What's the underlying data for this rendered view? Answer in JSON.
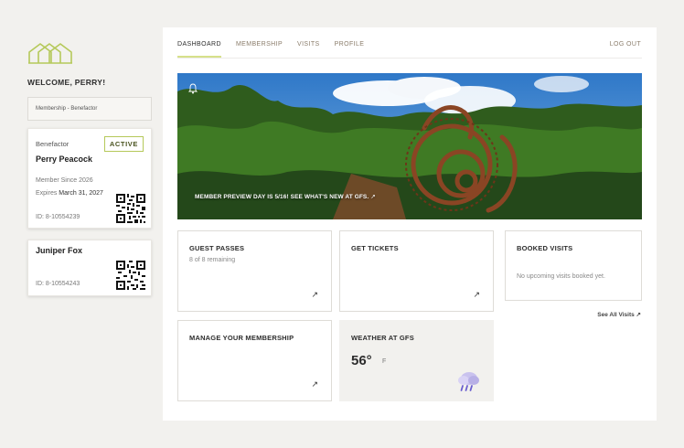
{
  "sidebar": {
    "logo": "home-outline-logo",
    "welcome": "WELCOME, PERRY!",
    "membership_select": "Membership - Benefactor",
    "cards": [
      {
        "tier": "Benefactor",
        "status": "ACTIVE",
        "name": "Perry Peacock",
        "since": "Member Since 2026",
        "expires_label": "Expires",
        "expires_date": "March 31, 2027",
        "id": "ID: 8-10554239"
      },
      {
        "name": "Juniper Fox",
        "id": "ID: 8-10554243"
      }
    ]
  },
  "nav": {
    "tabs": [
      "DASHBOARD",
      "MEMBERSHIP",
      "VISITS",
      "PROFILE"
    ],
    "active": "DASHBOARD",
    "logout": "LOG OUT"
  },
  "hero": {
    "text": "MEMBER PREVIEW DAY IS 5/16! SEE WHAT'S NEW AT GFS.",
    "arrow": "↗"
  },
  "tiles": {
    "guest_passes": {
      "title": "GUEST PASSES",
      "sub": "8 of 8 remaining",
      "arrow": "↗"
    },
    "tickets": {
      "title": "GET TICKETS",
      "arrow": "↗"
    },
    "booked": {
      "title": "BOOKED VISITS",
      "sub": "No upcoming visits booked yet."
    },
    "see_all": "See All Visits ↗",
    "manage": {
      "title": "MANAGE YOUR MEMBERSHIP",
      "arrow": "↗"
    },
    "weather": {
      "title": "WEATHER AT GFS",
      "temp": "56°",
      "unit": "F",
      "icon": "rain-cloud-icon"
    }
  },
  "colors": {
    "accent": "#d6e08a",
    "badge_border": "#b5c95a",
    "nav_muted": "#8b7d6b",
    "logo": "#b5c95a"
  }
}
